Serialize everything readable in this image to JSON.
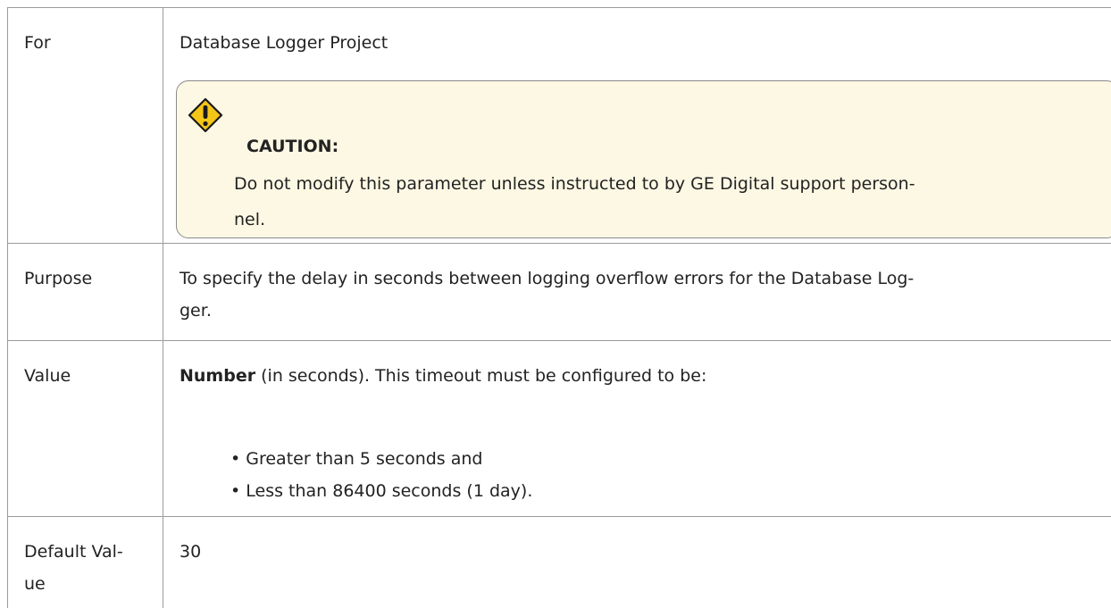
{
  "rows": {
    "for": {
      "label": "For",
      "value": "Database Logger Project",
      "caution": {
        "title": "CAUTION:",
        "lines": [
          "Do not modify this parameter unless instructed to by GE Digital support person-",
          "nel."
        ]
      }
    },
    "purpose": {
      "label": "Purpose",
      "lines": [
        "To specify the delay in seconds between logging overflow errors for the Database Log-",
        "ger."
      ]
    },
    "value": {
      "label": "Value",
      "bold_text": "Number",
      "rest_text": " (in seconds). This timeout must be configured to be:",
      "bullets": [
        "• Greater than 5 seconds and",
        "• Less than 86400 seconds (1 day)."
      ]
    },
    "default": {
      "label_lines": [
        "Default Val-",
        "ue"
      ],
      "value": "30"
    }
  },
  "colors": {
    "caution_background": "#fdf8e4",
    "caution_icon": "#f5c518",
    "border": "#9a9a9a"
  },
  "icons": {
    "caution": "warning-diamond-icon"
  }
}
